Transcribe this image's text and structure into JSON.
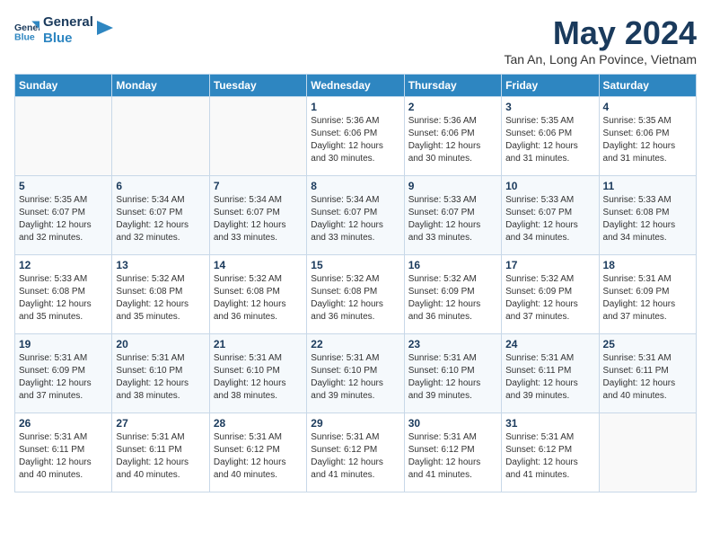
{
  "logo": {
    "line1": "General",
    "line2": "Blue"
  },
  "title": "May 2024",
  "subtitle": "Tan An, Long An Povince, Vietnam",
  "headers": [
    "Sunday",
    "Monday",
    "Tuesday",
    "Wednesday",
    "Thursday",
    "Friday",
    "Saturday"
  ],
  "weeks": [
    [
      {
        "day": "",
        "info": ""
      },
      {
        "day": "",
        "info": ""
      },
      {
        "day": "",
        "info": ""
      },
      {
        "day": "1",
        "info": "Sunrise: 5:36 AM\nSunset: 6:06 PM\nDaylight: 12 hours\nand 30 minutes."
      },
      {
        "day": "2",
        "info": "Sunrise: 5:36 AM\nSunset: 6:06 PM\nDaylight: 12 hours\nand 30 minutes."
      },
      {
        "day": "3",
        "info": "Sunrise: 5:35 AM\nSunset: 6:06 PM\nDaylight: 12 hours\nand 31 minutes."
      },
      {
        "day": "4",
        "info": "Sunrise: 5:35 AM\nSunset: 6:06 PM\nDaylight: 12 hours\nand 31 minutes."
      }
    ],
    [
      {
        "day": "5",
        "info": "Sunrise: 5:35 AM\nSunset: 6:07 PM\nDaylight: 12 hours\nand 32 minutes."
      },
      {
        "day": "6",
        "info": "Sunrise: 5:34 AM\nSunset: 6:07 PM\nDaylight: 12 hours\nand 32 minutes."
      },
      {
        "day": "7",
        "info": "Sunrise: 5:34 AM\nSunset: 6:07 PM\nDaylight: 12 hours\nand 33 minutes."
      },
      {
        "day": "8",
        "info": "Sunrise: 5:34 AM\nSunset: 6:07 PM\nDaylight: 12 hours\nand 33 minutes."
      },
      {
        "day": "9",
        "info": "Sunrise: 5:33 AM\nSunset: 6:07 PM\nDaylight: 12 hours\nand 33 minutes."
      },
      {
        "day": "10",
        "info": "Sunrise: 5:33 AM\nSunset: 6:07 PM\nDaylight: 12 hours\nand 34 minutes."
      },
      {
        "day": "11",
        "info": "Sunrise: 5:33 AM\nSunset: 6:08 PM\nDaylight: 12 hours\nand 34 minutes."
      }
    ],
    [
      {
        "day": "12",
        "info": "Sunrise: 5:33 AM\nSunset: 6:08 PM\nDaylight: 12 hours\nand 35 minutes."
      },
      {
        "day": "13",
        "info": "Sunrise: 5:32 AM\nSunset: 6:08 PM\nDaylight: 12 hours\nand 35 minutes."
      },
      {
        "day": "14",
        "info": "Sunrise: 5:32 AM\nSunset: 6:08 PM\nDaylight: 12 hours\nand 36 minutes."
      },
      {
        "day": "15",
        "info": "Sunrise: 5:32 AM\nSunset: 6:08 PM\nDaylight: 12 hours\nand 36 minutes."
      },
      {
        "day": "16",
        "info": "Sunrise: 5:32 AM\nSunset: 6:09 PM\nDaylight: 12 hours\nand 36 minutes."
      },
      {
        "day": "17",
        "info": "Sunrise: 5:32 AM\nSunset: 6:09 PM\nDaylight: 12 hours\nand 37 minutes."
      },
      {
        "day": "18",
        "info": "Sunrise: 5:31 AM\nSunset: 6:09 PM\nDaylight: 12 hours\nand 37 minutes."
      }
    ],
    [
      {
        "day": "19",
        "info": "Sunrise: 5:31 AM\nSunset: 6:09 PM\nDaylight: 12 hours\nand 37 minutes."
      },
      {
        "day": "20",
        "info": "Sunrise: 5:31 AM\nSunset: 6:10 PM\nDaylight: 12 hours\nand 38 minutes."
      },
      {
        "day": "21",
        "info": "Sunrise: 5:31 AM\nSunset: 6:10 PM\nDaylight: 12 hours\nand 38 minutes."
      },
      {
        "day": "22",
        "info": "Sunrise: 5:31 AM\nSunset: 6:10 PM\nDaylight: 12 hours\nand 39 minutes."
      },
      {
        "day": "23",
        "info": "Sunrise: 5:31 AM\nSunset: 6:10 PM\nDaylight: 12 hours\nand 39 minutes."
      },
      {
        "day": "24",
        "info": "Sunrise: 5:31 AM\nSunset: 6:11 PM\nDaylight: 12 hours\nand 39 minutes."
      },
      {
        "day": "25",
        "info": "Sunrise: 5:31 AM\nSunset: 6:11 PM\nDaylight: 12 hours\nand 40 minutes."
      }
    ],
    [
      {
        "day": "26",
        "info": "Sunrise: 5:31 AM\nSunset: 6:11 PM\nDaylight: 12 hours\nand 40 minutes."
      },
      {
        "day": "27",
        "info": "Sunrise: 5:31 AM\nSunset: 6:11 PM\nDaylight: 12 hours\nand 40 minutes."
      },
      {
        "day": "28",
        "info": "Sunrise: 5:31 AM\nSunset: 6:12 PM\nDaylight: 12 hours\nand 40 minutes."
      },
      {
        "day": "29",
        "info": "Sunrise: 5:31 AM\nSunset: 6:12 PM\nDaylight: 12 hours\nand 41 minutes."
      },
      {
        "day": "30",
        "info": "Sunrise: 5:31 AM\nSunset: 6:12 PM\nDaylight: 12 hours\nand 41 minutes."
      },
      {
        "day": "31",
        "info": "Sunrise: 5:31 AM\nSunset: 6:12 PM\nDaylight: 12 hours\nand 41 minutes."
      },
      {
        "day": "",
        "info": ""
      }
    ]
  ]
}
